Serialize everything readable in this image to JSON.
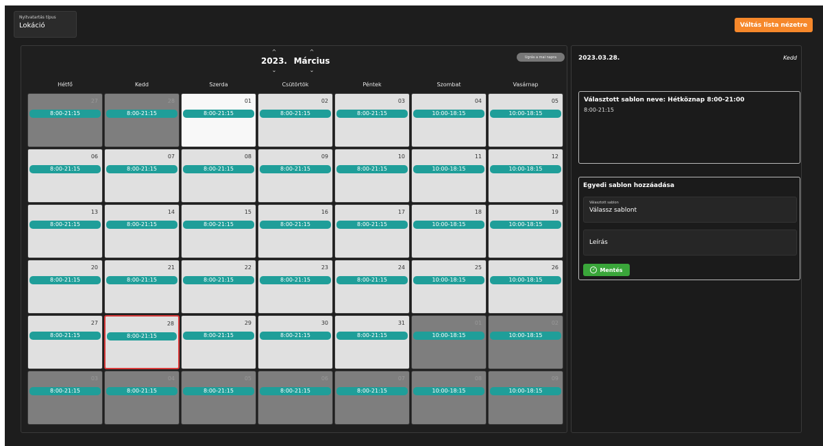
{
  "filter": {
    "label": "Nyitvatartás típus",
    "value": "Lokáció"
  },
  "switch_button": "Váltás lista nézetre",
  "calendar": {
    "year": "2023.",
    "month": "Március",
    "today_button": "Ugrás a mai napra",
    "weekdays": [
      "Hétfő",
      "Kedd",
      "Szerda",
      "Csütörtök",
      "Péntek",
      "Szombat",
      "Vasárnap"
    ],
    "weeks": [
      [
        {
          "day": "27",
          "hours": "8:00-21:15",
          "state": "other"
        },
        {
          "day": "28",
          "hours": "8:00-21:15",
          "state": "other"
        },
        {
          "day": "01",
          "hours": "8:00-21:15",
          "state": "today"
        },
        {
          "day": "02",
          "hours": "8:00-21:15",
          "state": "normal"
        },
        {
          "day": "03",
          "hours": "8:00-21:15",
          "state": "normal"
        },
        {
          "day": "04",
          "hours": "10:00-18:15",
          "state": "normal"
        },
        {
          "day": "05",
          "hours": "10:00-18:15",
          "state": "normal"
        }
      ],
      [
        {
          "day": "06",
          "hours": "8:00-21:15",
          "state": "normal"
        },
        {
          "day": "07",
          "hours": "8:00-21:15",
          "state": "normal"
        },
        {
          "day": "08",
          "hours": "8:00-21:15",
          "state": "normal"
        },
        {
          "day": "09",
          "hours": "8:00-21:15",
          "state": "normal"
        },
        {
          "day": "10",
          "hours": "8:00-21:15",
          "state": "normal"
        },
        {
          "day": "11",
          "hours": "10:00-18:15",
          "state": "normal"
        },
        {
          "day": "12",
          "hours": "10:00-18:15",
          "state": "normal"
        }
      ],
      [
        {
          "day": "13",
          "hours": "8:00-21:15",
          "state": "normal"
        },
        {
          "day": "14",
          "hours": "8:00-21:15",
          "state": "normal"
        },
        {
          "day": "15",
          "hours": "8:00-21:15",
          "state": "normal"
        },
        {
          "day": "16",
          "hours": "8:00-21:15",
          "state": "normal"
        },
        {
          "day": "17",
          "hours": "8:00-21:15",
          "state": "normal"
        },
        {
          "day": "18",
          "hours": "10:00-18:15",
          "state": "normal"
        },
        {
          "day": "19",
          "hours": "10:00-18:15",
          "state": "normal"
        }
      ],
      [
        {
          "day": "20",
          "hours": "8:00-21:15",
          "state": "normal"
        },
        {
          "day": "21",
          "hours": "8:00-21:15",
          "state": "normal"
        },
        {
          "day": "22",
          "hours": "8:00-21:15",
          "state": "normal"
        },
        {
          "day": "23",
          "hours": "8:00-21:15",
          "state": "normal"
        },
        {
          "day": "24",
          "hours": "8:00-21:15",
          "state": "normal"
        },
        {
          "day": "25",
          "hours": "10:00-18:15",
          "state": "normal"
        },
        {
          "day": "26",
          "hours": "10:00-18:15",
          "state": "normal"
        }
      ],
      [
        {
          "day": "27",
          "hours": "8:00-21:15",
          "state": "normal"
        },
        {
          "day": "28",
          "hours": "8:00-21:15",
          "state": "selected"
        },
        {
          "day": "29",
          "hours": "8:00-21:15",
          "state": "normal"
        },
        {
          "day": "30",
          "hours": "8:00-21:15",
          "state": "normal"
        },
        {
          "day": "31",
          "hours": "8:00-21:15",
          "state": "normal"
        },
        {
          "day": "01",
          "hours": "10:00-18:15",
          "state": "other"
        },
        {
          "day": "02",
          "hours": "10:00-18:15",
          "state": "other"
        }
      ],
      [
        {
          "day": "03",
          "hours": "8:00-21:15",
          "state": "other"
        },
        {
          "day": "04",
          "hours": "8:00-21:15",
          "state": "other"
        },
        {
          "day": "05",
          "hours": "8:00-21:15",
          "state": "other"
        },
        {
          "day": "06",
          "hours": "8:00-21:15",
          "state": "other"
        },
        {
          "day": "07",
          "hours": "8:00-21:15",
          "state": "other"
        },
        {
          "day": "08",
          "hours": "10:00-18:15",
          "state": "other"
        },
        {
          "day": "09",
          "hours": "10:00-18:15",
          "state": "other"
        }
      ]
    ]
  },
  "side": {
    "date": "2023.03.28.",
    "day_name": "Kedd",
    "template_title": "Választott sablon neve: Hétköznap 8:00-21:00",
    "template_hours": "8:00-21:15",
    "custom_title": "Egyedi sablon hozzáadása",
    "select_label": "Választott sablon",
    "select_value": "Válassz sablont",
    "description_placeholder": "Leírás",
    "save_label": "Mentés"
  },
  "colors": {
    "accent_orange": "#f6882b",
    "pill_teal": "#1f9e99",
    "save_green": "#3aa63a",
    "selected_red": "#d93a3a"
  }
}
